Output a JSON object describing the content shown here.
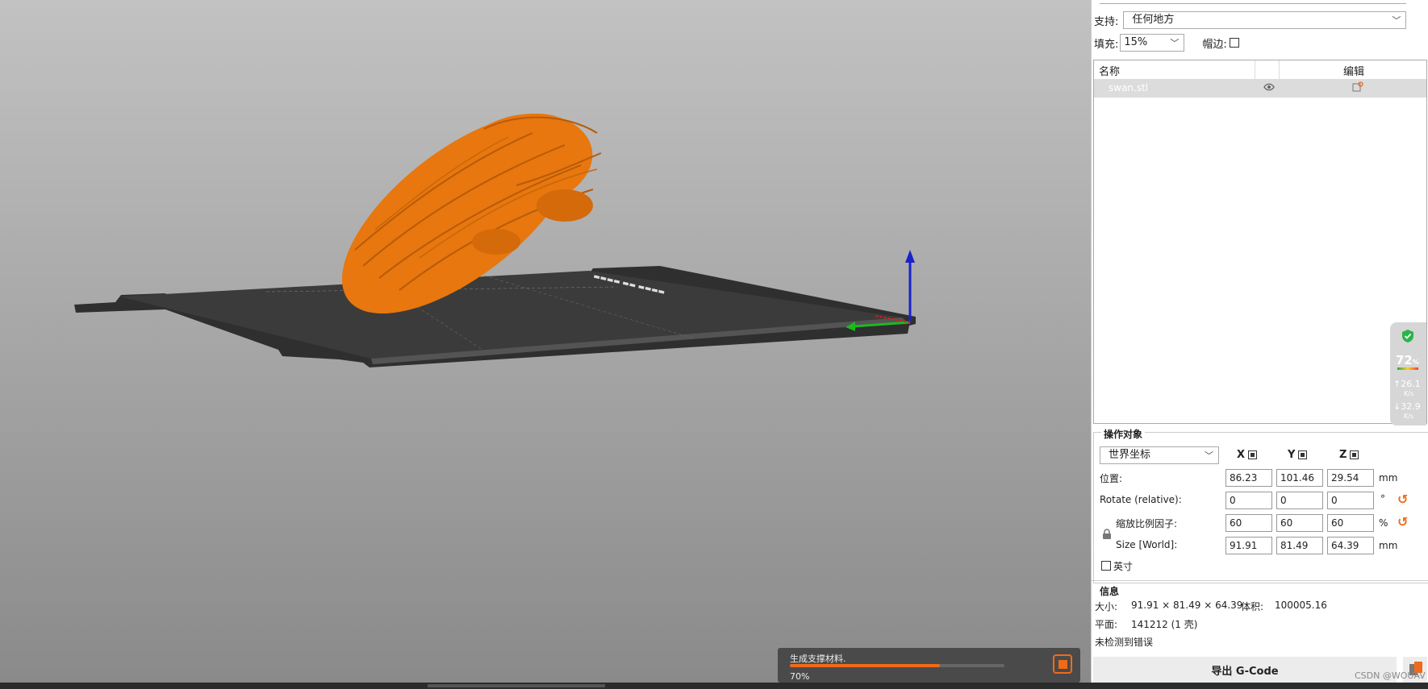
{
  "viewport": {
    "model_color": "#e7770e",
    "plate_color": "#333333",
    "accent": "#f06a19"
  },
  "progress": {
    "label": "生成支撑材料.",
    "percent_text": "70%",
    "value": 0.7
  },
  "settings": {
    "support_label": "支持:",
    "support_value": "任何地方",
    "infill_label": "填充:",
    "infill_value": "15%",
    "brim_label": "帽边:"
  },
  "object_list": {
    "col_name": "名称",
    "col_edit": "编辑",
    "items": [
      {
        "name": "swan.stl"
      }
    ]
  },
  "manipulation": {
    "title": "操作对象",
    "coord_system": "世界坐标",
    "axes": [
      "X",
      "Y",
      "Z"
    ],
    "position": {
      "label": "位置:",
      "values": [
        "86.23",
        "101.46",
        "29.54"
      ],
      "unit": "mm"
    },
    "rotate": {
      "label": "Rotate (relative):",
      "values": [
        "0",
        "0",
        "0"
      ],
      "unit": "°"
    },
    "scale": {
      "label": "缩放比例因子:",
      "values": [
        "60",
        "60",
        "60"
      ],
      "unit": "%"
    },
    "size": {
      "label": "Size [World]:",
      "values": [
        "91.91",
        "81.49",
        "64.39"
      ],
      "unit": "mm"
    },
    "inches_label": "英寸"
  },
  "info": {
    "title": "信息",
    "size_label": "大小:",
    "size_value": "91.91 × 81.49 × 64.39",
    "volume_label": "体积:",
    "volume_value": "100005.16",
    "facets_label": "平面:",
    "facets_value": "141212 (1 壳)",
    "errors": "未检测到错误"
  },
  "export_button": "导出 G-Code",
  "net_widget": {
    "percent": "72",
    "percent_unit": "%",
    "up": "26.1",
    "up_unit": "K/s",
    "down": "32.9",
    "down_unit": "K/s"
  },
  "watermark": "CSDN @WOUAV"
}
